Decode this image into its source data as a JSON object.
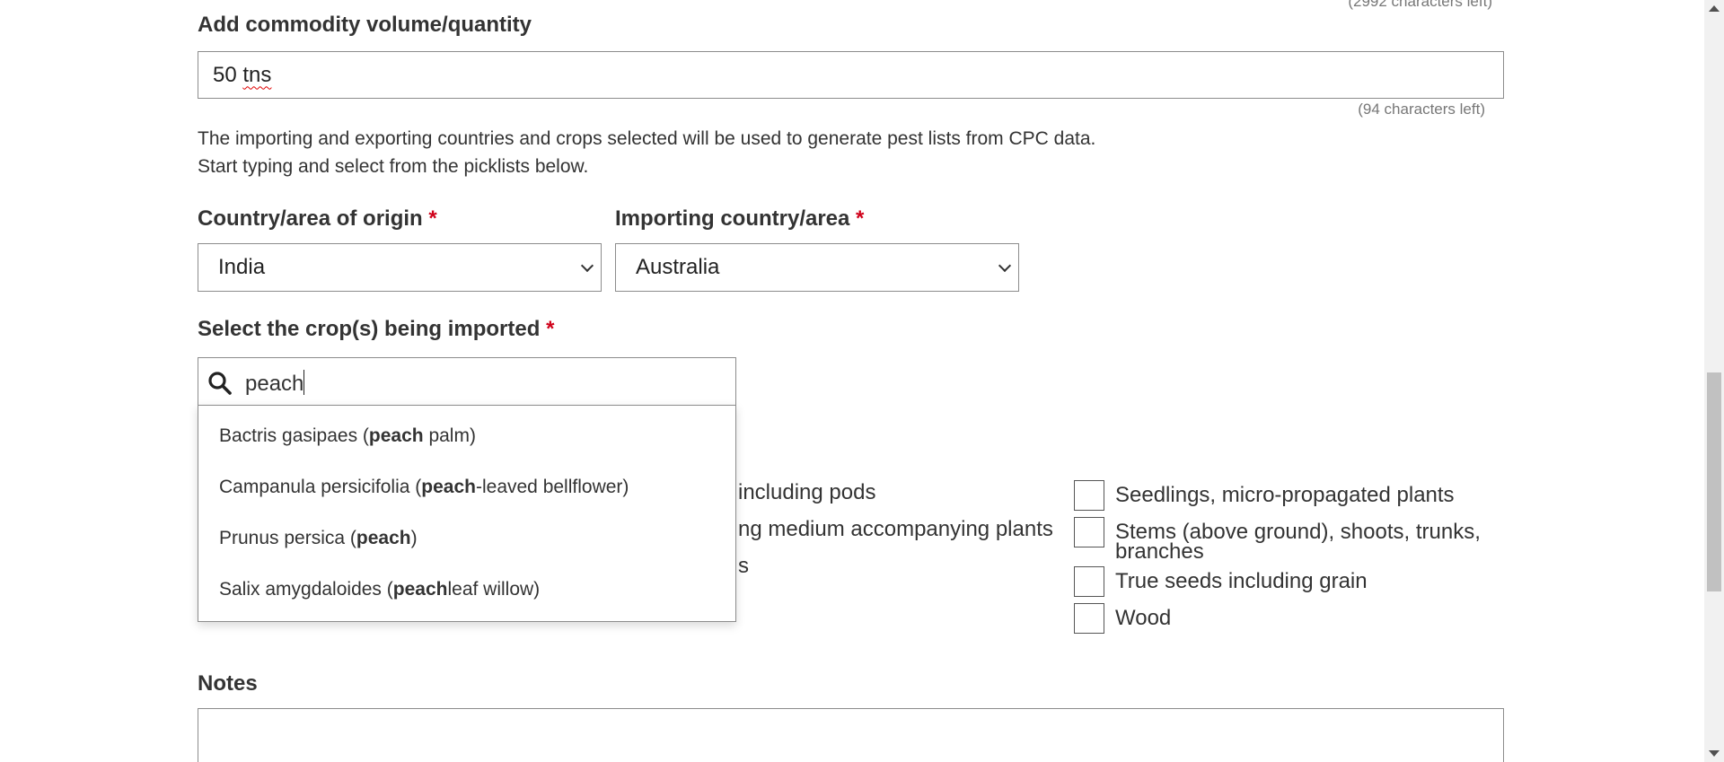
{
  "form": {
    "description_chars_left": "(2992 characters left)",
    "quantity": {
      "label": "Add commodity volume/quantity",
      "value_prefix": "50 ",
      "value_misspelled": "tns",
      "chars_left": "(94 characters left)"
    },
    "info": {
      "line1": "The importing and exporting countries and crops selected will be used to generate pest lists from CPC data.",
      "line2": "Start typing and select from the picklists below."
    },
    "origin": {
      "label": "Country/area of origin",
      "required": "*",
      "value": "India"
    },
    "importing": {
      "label": "Importing country/area",
      "required": "*",
      "value": "Australia"
    },
    "crops": {
      "label": "Select the crop(s) being imported",
      "required": "*",
      "search_value": "peach",
      "suggestions": [
        {
          "before": "Bactris gasipaes (",
          "match": "peach",
          "after": " palm)"
        },
        {
          "before": "Campanula persicifolia (",
          "match": "peach",
          "after": "-leaved bellflower)"
        },
        {
          "before": "Prunus persica (",
          "match": "peach",
          "after": ")"
        },
        {
          "before": "Salix amygdaloides (",
          "match": "peach",
          "after": "leaf willow)"
        }
      ]
    },
    "pathway_partial": {
      "item1": "including pods",
      "item2": "ng medium accompanying plants",
      "item3": "s"
    },
    "pathway_options": [
      {
        "label": "Seedlings, micro-propagated plants",
        "checked": false
      },
      {
        "label": "Stems (above ground), shoots, trunks, branches",
        "checked": false
      },
      {
        "label": "True seeds including grain",
        "checked": false
      },
      {
        "label": "Wood",
        "checked": false
      }
    ],
    "notes": {
      "label": "Notes",
      "value": ""
    }
  },
  "icons": {
    "search": "search-icon",
    "dropdown": "chevron-down-icon"
  },
  "colors": {
    "required": "#d0021b",
    "border": "#8c8c8c",
    "text": "#333333"
  }
}
